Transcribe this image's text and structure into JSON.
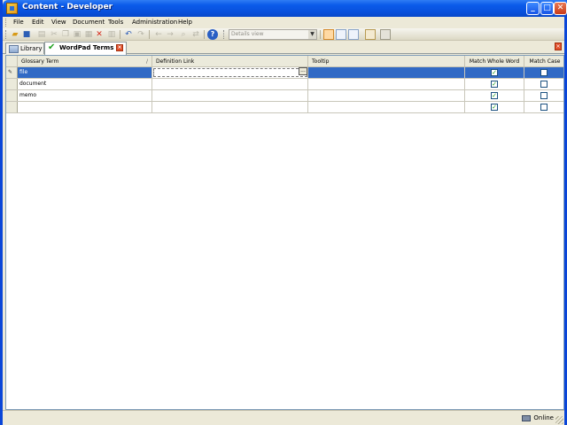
{
  "window": {
    "title": "Content - Developer",
    "controls": {
      "minimize": "_",
      "maximize": "□",
      "close": "✕"
    }
  },
  "menu": {
    "items": [
      "File",
      "Edit",
      "View",
      "Document",
      "Tools",
      "Administration",
      "Help"
    ]
  },
  "toolbar": {
    "view_select": "Details view",
    "icons": [
      "open-folder",
      "save",
      "print",
      "cut",
      "copy",
      "paste",
      "delete",
      "properties",
      "undo",
      "redo",
      "back",
      "forward",
      "find",
      "replace",
      "help"
    ]
  },
  "tabs": [
    {
      "label": "Library",
      "icon": "library-icon",
      "active": false
    },
    {
      "label": "WordPad Terms",
      "icon": "checkmark-icon",
      "active": true
    }
  ],
  "grid": {
    "columns": [
      "Glossary Term",
      "Definition Link",
      "Tooltip",
      "Match Whole Word",
      "Match Case"
    ],
    "sort_indicator": "/",
    "rows": [
      {
        "term": "file",
        "link": "",
        "tooltip": "",
        "match_whole_word": true,
        "match_case": false,
        "editing": true,
        "selected": true
      },
      {
        "term": "document",
        "link": "",
        "tooltip": "",
        "match_whole_word": true,
        "match_case": false
      },
      {
        "term": "memo",
        "link": "",
        "tooltip": "",
        "match_whole_word": true,
        "match_case": false
      },
      {
        "term": "",
        "link": "",
        "tooltip": "",
        "match_whole_word": true,
        "match_case": false
      }
    ],
    "ellipsis": "..."
  },
  "status": {
    "connection": "Online"
  },
  "colors": {
    "titlebar": "#0b5bea",
    "selection": "#316ac5",
    "checkmark": "#21a121"
  }
}
